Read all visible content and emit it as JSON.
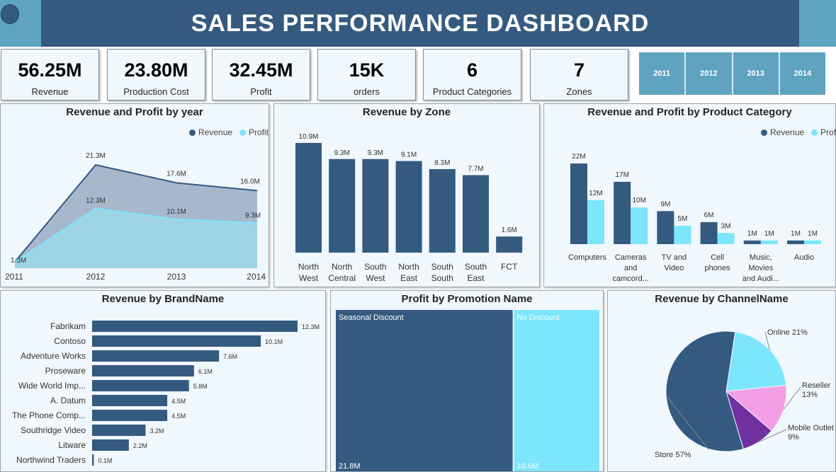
{
  "header": {
    "title": "SALES PERFORMANCE DASHBOARD"
  },
  "kpis": [
    {
      "value": "56.25M",
      "label": "Revenue"
    },
    {
      "value": "23.80M",
      "label": "Production Cost"
    },
    {
      "value": "32.45M",
      "label": "Profit"
    },
    {
      "value": "15K",
      "label": "orders"
    },
    {
      "value": "6",
      "label": "Product Categories"
    },
    {
      "value": "7",
      "label": "Zones"
    }
  ],
  "year_slicer": [
    "2011",
    "2012",
    "2013",
    "2014"
  ],
  "colors": {
    "revenue": "#345a80",
    "profit": "#7de5fc",
    "accent": "#5fa3c0",
    "reseller": "#f49ee6",
    "mobile": "#7030a0"
  },
  "panels": {
    "rev_profit_year": {
      "title": "Revenue and Profit by year",
      "legend": [
        "Revenue",
        "Profit"
      ],
      "x": [
        "2011",
        "2012",
        "2013",
        "2014"
      ],
      "revenue": [
        1.3,
        21.3,
        17.6,
        16.0
      ],
      "profit": [
        1.3,
        12.3,
        10.1,
        9.3
      ],
      "revenue_labels": [
        "1.3M",
        "21.3M",
        "17.6M",
        "16.0M"
      ],
      "profit_labels": [
        "",
        "12.3M",
        "10.1M",
        "9.3M"
      ]
    },
    "rev_zone": {
      "title": "Revenue by Zone",
      "categories": [
        [
          "North",
          "West"
        ],
        [
          "North",
          "Central"
        ],
        [
          "South",
          "West"
        ],
        [
          "North",
          "East"
        ],
        [
          "South",
          "South"
        ],
        [
          "South",
          "East"
        ],
        [
          "FCT"
        ]
      ],
      "values": [
        10.9,
        9.3,
        9.3,
        9.1,
        8.3,
        7.7,
        1.6
      ],
      "labels": [
        "10.9M",
        "9.3M",
        "9.3M",
        "9.1M",
        "8.3M",
        "7.7M",
        "1.6M"
      ]
    },
    "rev_profit_category": {
      "title": "Revenue and Profit by Product Category",
      "legend": [
        "Revenue",
        "Profit"
      ],
      "categories": [
        [
          "Computers"
        ],
        [
          "Cameras",
          "and",
          "camcord..."
        ],
        [
          "TV and",
          "Video"
        ],
        [
          "Cell",
          "phones"
        ],
        [
          "Music,",
          "Movies",
          "and Audi..."
        ],
        [
          "Audio"
        ]
      ],
      "revenue": [
        22,
        17,
        9,
        6,
        1,
        1
      ],
      "profit": [
        12,
        10,
        5,
        3,
        1,
        1
      ],
      "revenue_labels": [
        "22M",
        "17M",
        "9M",
        "6M",
        "1M",
        "1M"
      ],
      "profit_labels": [
        "12M",
        "10M",
        "5M",
        "3M",
        "1M",
        "1M"
      ]
    },
    "rev_brand": {
      "title": "Revenue by BrandName",
      "categories": [
        "Fabrikam",
        "Contoso",
        "Adventure Works",
        "Proseware",
        "Wide World Imp...",
        "A. Datum",
        "The Phone Comp...",
        "Southridge Video",
        "Litware",
        "Northwind Traders"
      ],
      "values": [
        12.3,
        10.1,
        7.6,
        6.1,
        5.8,
        4.5,
        4.5,
        3.2,
        2.2,
        0.1
      ],
      "labels": [
        "12.3M",
        "10.1M",
        "7.6M",
        "6.1M",
        "5.8M",
        "4.5M",
        "4.5M",
        "3.2M",
        "2.2M",
        "0.1M"
      ]
    },
    "profit_promo": {
      "title": "Profit by Promotion Name",
      "items": [
        {
          "name": "Seasonal Discount",
          "value": 21.8,
          "label": "21.8M"
        },
        {
          "name": "No Discount",
          "value": 10.6,
          "label": "10.6M"
        }
      ]
    },
    "rev_channel": {
      "title": "Revenue by ChannelName",
      "slices": [
        {
          "name": "Online",
          "pct": 21,
          "label": [
            "Online 21%"
          ]
        },
        {
          "name": "Reseller",
          "pct": 13,
          "label": [
            "Reseller",
            "13%"
          ]
        },
        {
          "name": "Mobile Outlet",
          "pct": 9,
          "label": [
            "Mobile Outlet",
            "9%"
          ]
        },
        {
          "name": "Store",
          "pct": 57,
          "label": [
            "Store 57%"
          ]
        }
      ]
    }
  }
}
